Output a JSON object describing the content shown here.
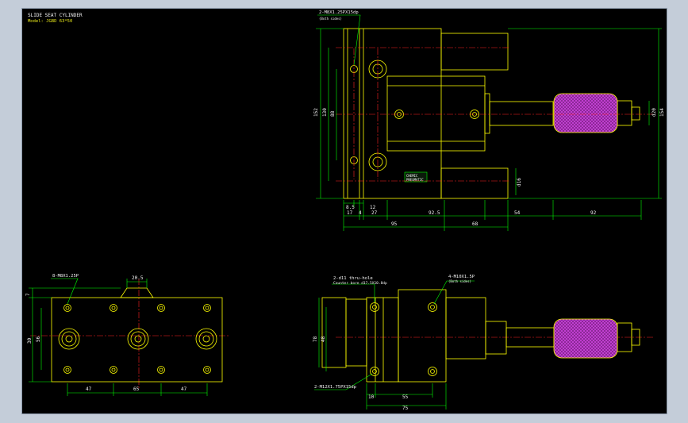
{
  "window": {
    "frame_color": "#c4cdd9",
    "border_color": "#8d9aab",
    "canvas_color": "#000000"
  },
  "colors": {
    "part": "#ffff00",
    "dimension": "#00ff00",
    "centerline": "#ff2020",
    "text": "#f3f3f3",
    "knob": "#c03fd0"
  },
  "title_block": {
    "title": "SLIDE SEAT CYLINDER",
    "model": "Model: JGBD 63*50"
  },
  "dims_top": {
    "horizontal_1": [
      "8.5",
      "12"
    ],
    "horizontal_2": [
      "17",
      "4",
      "27",
      "92.5",
      "54",
      "92"
    ],
    "horizontal_3": [
      "95",
      "68"
    ],
    "vertical_left": [
      "152",
      "130",
      "88"
    ],
    "vertical_right": [
      "d20",
      "154"
    ],
    "rod_dia": "d16"
  },
  "notes_top": {
    "thread": "2-M8X1.25PX15dp",
    "thread_sub": "(Both sides)",
    "brand": "CHEMIC",
    "brand_sub": "PNEUMATIC"
  },
  "dims_bottom_left": {
    "holes": "8-M8X1.25P",
    "top": "20.5",
    "vertical": [
      "7",
      "30",
      "56"
    ],
    "bottom": [
      "47",
      "65",
      "47"
    ]
  },
  "dims_bottom_right": {
    "note_1": "2-d11 thru-hole",
    "note_1_sub": "Counter bore d17.5X10.8dp",
    "note_2": "4-M10X1.5P",
    "note_2_sub": "(Both sides)",
    "note_3": "2-M12X1.75PX15dp",
    "vertical": [
      "78",
      "48"
    ],
    "bottom": [
      "10",
      "55",
      "75"
    ]
  }
}
